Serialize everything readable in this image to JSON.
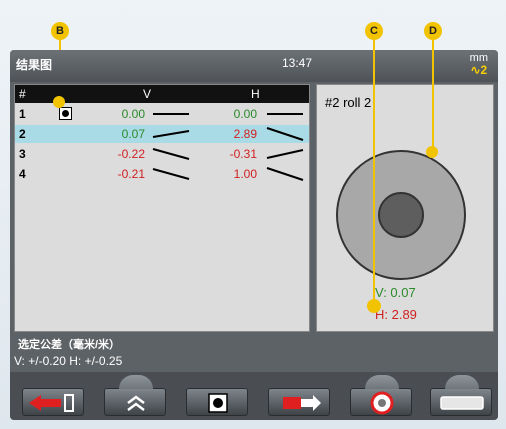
{
  "header": {
    "title": "结果图",
    "time": "13:47",
    "unit": "mm",
    "unit_level": "2"
  },
  "table": {
    "columns": [
      "#",
      "V",
      "H"
    ],
    "rows": [
      {
        "index": "1",
        "v": "0.00",
        "h": "0.00",
        "v_color": "green",
        "h_color": "green",
        "selected": false,
        "checked": true
      },
      {
        "index": "2",
        "v": "0.07",
        "h": "2.89",
        "v_color": "green",
        "h_color": "red",
        "selected": true,
        "checked": false
      },
      {
        "index": "3",
        "v": "-0.22",
        "h": "-0.31",
        "v_color": "red",
        "h_color": "red",
        "selected": false,
        "checked": false
      },
      {
        "index": "4",
        "v": "-0.21",
        "h": "1.00",
        "v_color": "red",
        "h_color": "red",
        "selected": false,
        "checked": false
      }
    ]
  },
  "roll": {
    "title": "#2 roll 2",
    "v_text": "V: 0.07",
    "h_text": "H: 2.89"
  },
  "tolerance": {
    "label": "选定公差（毫米/米）",
    "values": "V: +/-0.20   H: +/-0.25"
  },
  "markers": {
    "b": "B",
    "c": "C",
    "d": "D"
  },
  "buttons": [
    {
      "name": "exit-button",
      "icon": "exit-arrow-icon"
    },
    {
      "name": "scroll-up-button",
      "icon": "double-chevron-up-icon"
    },
    {
      "name": "select-button",
      "icon": "checkbox-icon"
    },
    {
      "name": "transfer-button",
      "icon": "transfer-arrow-icon"
    },
    {
      "name": "roll-view-button",
      "icon": "roll-icon"
    },
    {
      "name": "roll-side-button",
      "icon": "roll-side-icon"
    }
  ],
  "colors": {
    "green": "#2a8a2a",
    "red": "#d02020",
    "selected_row": "#a9dbe6",
    "marker": "#f2c300"
  }
}
